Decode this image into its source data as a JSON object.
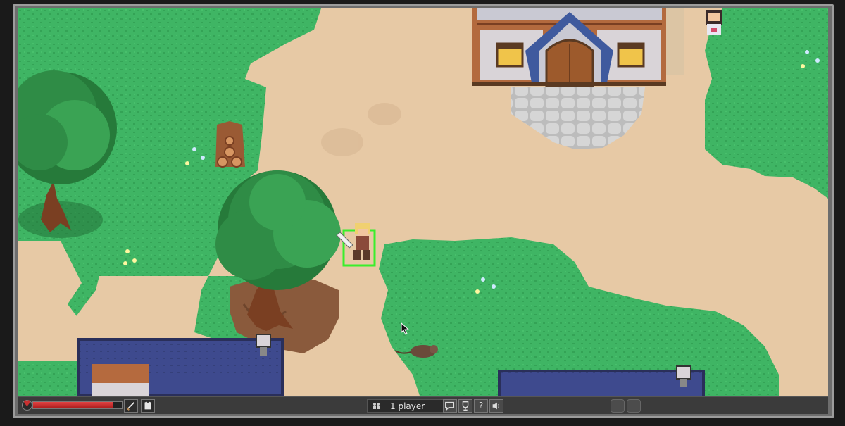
{
  "game": {
    "hud": {
      "health_fraction": 0.9,
      "players_label": "1 player",
      "icons": {
        "health": "heart-icon",
        "weapon": "sword-icon",
        "armor": "armor-icon",
        "population": "population-icon",
        "chat": "chat-icon",
        "achievements": "trophy-icon",
        "help": "help-icon",
        "sound": "speaker-icon"
      },
      "help_glyph": "?"
    },
    "colors": {
      "grass": "#3fb564",
      "sand": "#e7c9a5",
      "water": "#3e4a8e",
      "health": "#d93030",
      "target": "#3aee2c"
    }
  }
}
